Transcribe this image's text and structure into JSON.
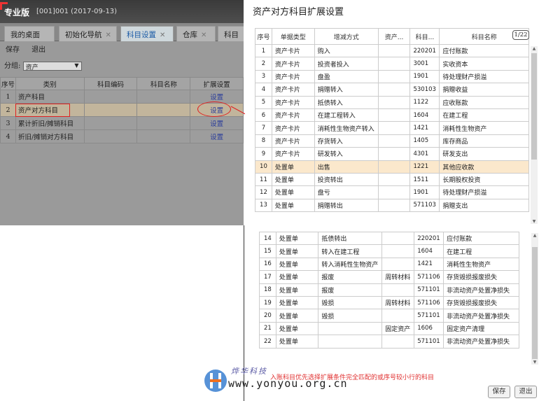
{
  "app": {
    "edition": "专业版",
    "context": "[001]001   (2017-09-13)",
    "tabs": [
      {
        "label": "我的桌面"
      },
      {
        "label": "初始化导航"
      },
      {
        "label": "科目设置"
      },
      {
        "label": "仓库"
      },
      {
        "label": "科目"
      }
    ],
    "toolbar": {
      "save": "保存",
      "exit": "退出"
    },
    "group_label": "分组:",
    "group_value": "资产",
    "table": {
      "headers": [
        "序号",
        "类别",
        "科目编码",
        "科目名称",
        "扩展设置"
      ],
      "rows": [
        {
          "seq": "1",
          "category": "资产科目",
          "code": "",
          "name": "",
          "action": "设置"
        },
        {
          "seq": "2",
          "category": "资产对方科目",
          "code": "",
          "name": "",
          "action": "设置"
        },
        {
          "seq": "3",
          "category": "累计折旧/摊销科目",
          "code": "",
          "name": "",
          "action": "设置"
        },
        {
          "seq": "4",
          "category": "折旧/摊销对方科目",
          "code": "",
          "name": "",
          "action": "设置"
        }
      ]
    }
  },
  "dialog": {
    "title": "资产对方科目扩展设置",
    "page_indicator": "1/22",
    "headers": [
      "序号",
      "单据类型",
      "增减方式",
      "资产...",
      "科目...",
      "科目名称"
    ],
    "rows_top": [
      {
        "seq": "1",
        "doc": "资产卡片",
        "method": "购入",
        "asset": "",
        "code": "220201",
        "name": "应付账款"
      },
      {
        "seq": "2",
        "doc": "资产卡片",
        "method": "投资者投入",
        "asset": "",
        "code": "3001",
        "name": "实收资本"
      },
      {
        "seq": "3",
        "doc": "资产卡片",
        "method": "盘盈",
        "asset": "",
        "code": "1901",
        "name": "待处理财产损溢"
      },
      {
        "seq": "4",
        "doc": "资产卡片",
        "method": "捐赠转入",
        "asset": "",
        "code": "530103",
        "name": "捐赠收益"
      },
      {
        "seq": "5",
        "doc": "资产卡片",
        "method": "抵债转入",
        "asset": "",
        "code": "1122",
        "name": "应收账款"
      },
      {
        "seq": "6",
        "doc": "资产卡片",
        "method": "在建工程转入",
        "asset": "",
        "code": "1604",
        "name": "在建工程"
      },
      {
        "seq": "7",
        "doc": "资产卡片",
        "method": "消耗性生物资产转入",
        "asset": "",
        "code": "1421",
        "name": "消耗性生物资产"
      },
      {
        "seq": "8",
        "doc": "资产卡片",
        "method": "存货转入",
        "asset": "",
        "code": "1405",
        "name": "库存商品"
      },
      {
        "seq": "9",
        "doc": "资产卡片",
        "method": "研发转入",
        "asset": "",
        "code": "4301",
        "name": "研发支出"
      },
      {
        "seq": "10",
        "doc": "处置单",
        "method": "出售",
        "asset": "",
        "code": "1221",
        "name": "其他应收款"
      },
      {
        "seq": "11",
        "doc": "处置单",
        "method": "投资转出",
        "asset": "",
        "code": "1511",
        "name": "长期股权投资"
      },
      {
        "seq": "12",
        "doc": "处置单",
        "method": "盘亏",
        "asset": "",
        "code": "1901",
        "name": "待处理财产损溢"
      },
      {
        "seq": "13",
        "doc": "处置单",
        "method": "捐赠转出",
        "asset": "",
        "code": "571103",
        "name": "捐赠支出"
      }
    ],
    "rows_bottom": [
      {
        "seq": "14",
        "doc": "处置单",
        "method": "抵债转出",
        "asset": "",
        "code": "220201",
        "name": "应付账款"
      },
      {
        "seq": "15",
        "doc": "处置单",
        "method": "转入在建工程",
        "asset": "",
        "code": "1604",
        "name": "在建工程"
      },
      {
        "seq": "16",
        "doc": "处置单",
        "method": "转入消耗性生物资产",
        "asset": "",
        "code": "1421",
        "name": "消耗性生物资产"
      },
      {
        "seq": "17",
        "doc": "处置单",
        "method": "报废",
        "asset": "周转材料",
        "code": "571106",
        "name": "存货毁损报废损失"
      },
      {
        "seq": "18",
        "doc": "处置单",
        "method": "报废",
        "asset": "",
        "code": "571101",
        "name": "非流动资产处置净损失"
      },
      {
        "seq": "19",
        "doc": "处置单",
        "method": "毁损",
        "asset": "周转材料",
        "code": "571106",
        "name": "存货毁损报废损失"
      },
      {
        "seq": "20",
        "doc": "处置单",
        "method": "毁损",
        "asset": "",
        "code": "571101",
        "name": "非流动资产处置净损失"
      },
      {
        "seq": "21",
        "doc": "处置单",
        "method": "",
        "asset": "固定资产",
        "code": "1606",
        "name": "固定资产清理"
      },
      {
        "seq": "22",
        "doc": "处置单",
        "method": "",
        "asset": "",
        "code": "571101",
        "name": "非流动资产处置净损失"
      }
    ],
    "note": "入账科目优先选择扩展条件完全匹配的或序号较小行的科目",
    "save": "保存",
    "exit": "退出"
  },
  "watermark": {
    "text": "烨华科技",
    "url": "www.yonyou.org.cn"
  }
}
